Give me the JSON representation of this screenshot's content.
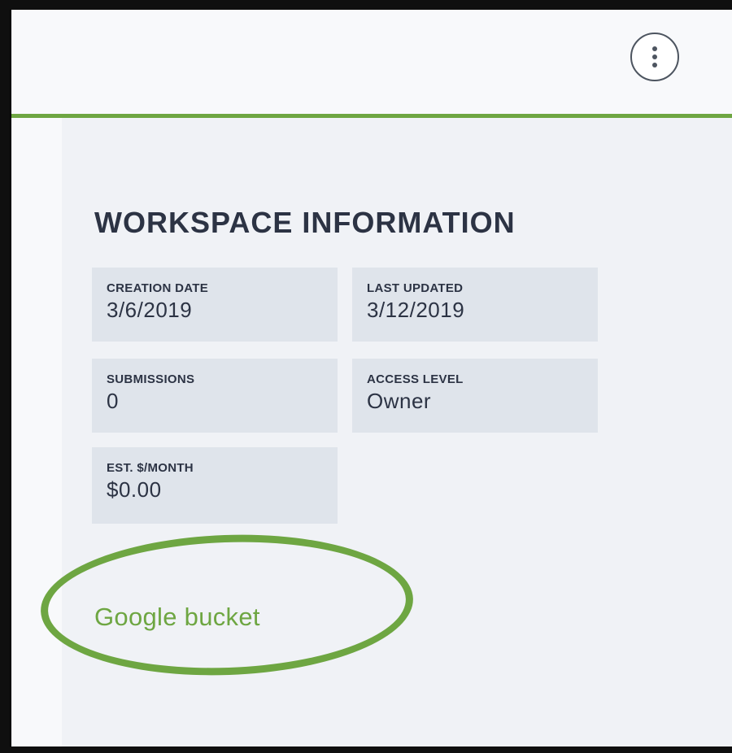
{
  "header": {
    "menu_icon": "kebab-menu-icon"
  },
  "workspace_info": {
    "title": "WORKSPACE INFORMATION",
    "cards": [
      {
        "label": "CREATION DATE",
        "value": "3/6/2019"
      },
      {
        "label": "LAST UPDATED",
        "value": "3/12/2019"
      },
      {
        "label": "SUBMISSIONS",
        "value": "0"
      },
      {
        "label": "ACCESS LEVEL",
        "value": "Owner"
      },
      {
        "label": "EST. $/MONTH",
        "value": "$0.00"
      }
    ],
    "bucket_link": "Google bucket"
  },
  "colors": {
    "accent_green": "#6ea642",
    "text_dark": "#2c3344",
    "card_bg": "#dfe4eb",
    "panel_bg": "#f0f2f6"
  }
}
